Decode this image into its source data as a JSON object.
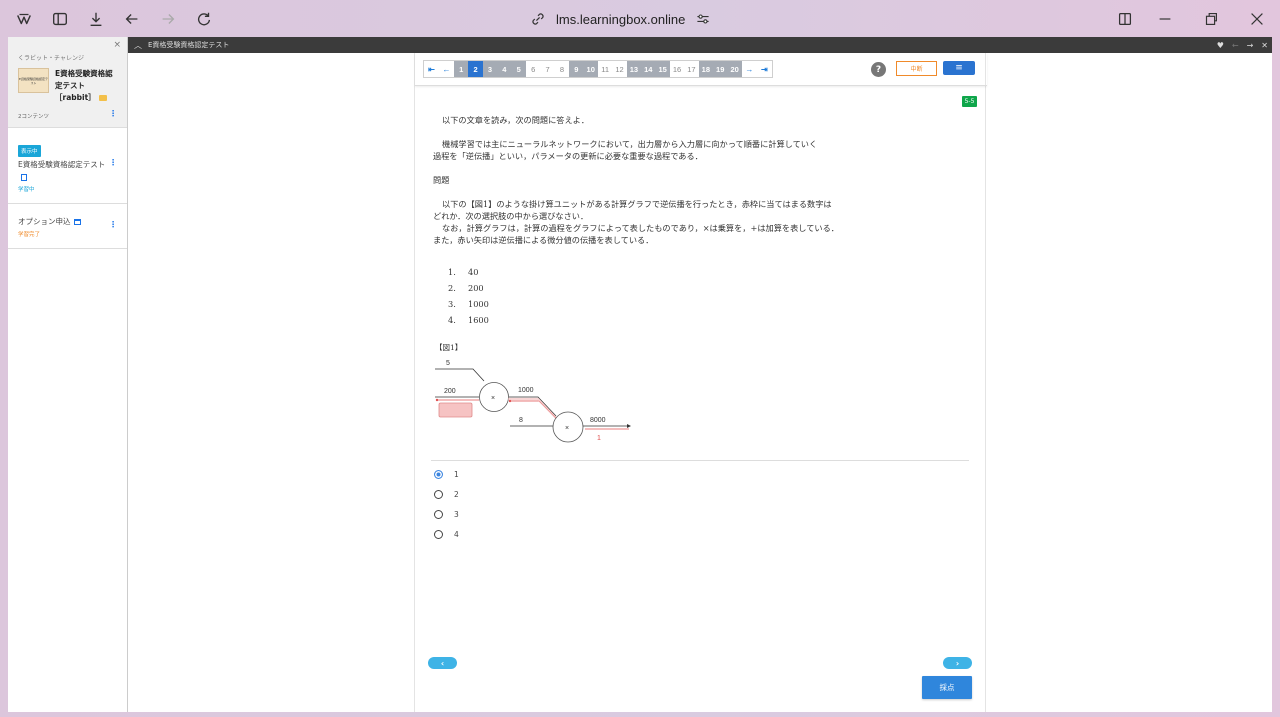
{
  "browser": {
    "url": "lms.learningbox.online"
  },
  "strip": {
    "title": "E資格受験資格認定テスト"
  },
  "sidebar": {
    "close": "×",
    "breadcrumb": "くラビット・チャレンジ",
    "thumbnail_text": "E資格受験資格認定テスト",
    "course_title": "E資格受験資格認定テスト［rabbit］",
    "content_count": "2コンテンツ",
    "items": [
      {
        "badge": "表示中",
        "title": "E資格受験資格認定テスト",
        "status": "学習中",
        "status_color": "#1aa6d8"
      },
      {
        "title": "オプション申込",
        "status": "学習完了",
        "status_color": "#f08a2a"
      }
    ]
  },
  "navbar": {
    "first": "⇤",
    "prev": "←",
    "next": "→",
    "last": "⇥",
    "pages": [
      {
        "n": "1",
        "state": "ans"
      },
      {
        "n": "2",
        "state": "cur"
      },
      {
        "n": "3",
        "state": "ans"
      },
      {
        "n": "4",
        "state": "ans"
      },
      {
        "n": "5",
        "state": "ans"
      },
      {
        "n": "6",
        "state": "un"
      },
      {
        "n": "7",
        "state": "un"
      },
      {
        "n": "8",
        "state": "un"
      },
      {
        "n": "9",
        "state": "ans"
      },
      {
        "n": "10",
        "state": "ans"
      },
      {
        "n": "11",
        "state": "un"
      },
      {
        "n": "12",
        "state": "un"
      },
      {
        "n": "13",
        "state": "ans"
      },
      {
        "n": "14",
        "state": "ans"
      },
      {
        "n": "15",
        "state": "ans"
      },
      {
        "n": "16",
        "state": "un"
      },
      {
        "n": "17",
        "state": "un"
      },
      {
        "n": "18",
        "state": "ans"
      },
      {
        "n": "19",
        "state": "ans"
      },
      {
        "n": "20",
        "state": "ans"
      }
    ],
    "help": "?",
    "suspend": "中断",
    "menu": "≡"
  },
  "question": {
    "badge": "5-5",
    "intro": "以下の文章を読み，次の問題に答えよ．",
    "body_line1": "機械学習では主にニューラルネットワークにおいて，出力層から入力層に向かって順番に計算していく",
    "body_line2": "過程を「逆伝播」といい，パラメータの更新に必要な重要な過程である．",
    "heading": "問題",
    "q_line1": "以下の【図1】のような掛け算ユニットがある計算グラフで逆伝播を行ったとき，赤枠に当てはまる数字は",
    "q_line2": "どれか．次の選択肢の中から選びなさい．",
    "q_line3": "なお，計算グラフは，計算の過程をグラフによって表したものであり，×は乗算を，+は加算を表している．",
    "q_line4": "また，赤い矢印は逆伝播による微分値の伝播を表している．",
    "choices": [
      {
        "num": "1.",
        "text": "40"
      },
      {
        "num": "2.",
        "text": "200"
      },
      {
        "num": "3.",
        "text": "1000"
      },
      {
        "num": "4.",
        "text": "1600"
      }
    ],
    "figure": {
      "label": "【図1】",
      "in_top": "5",
      "in_mid": "200",
      "mid_out": "1000",
      "in_bottom": "8",
      "out": "8000",
      "grad_out": "1",
      "op1": "×",
      "op2": "×"
    }
  },
  "answers": {
    "selected": "1",
    "options": [
      "1",
      "2",
      "3",
      "4"
    ]
  },
  "footer": {
    "prev": "‹",
    "next": "›",
    "grade": "採点"
  }
}
